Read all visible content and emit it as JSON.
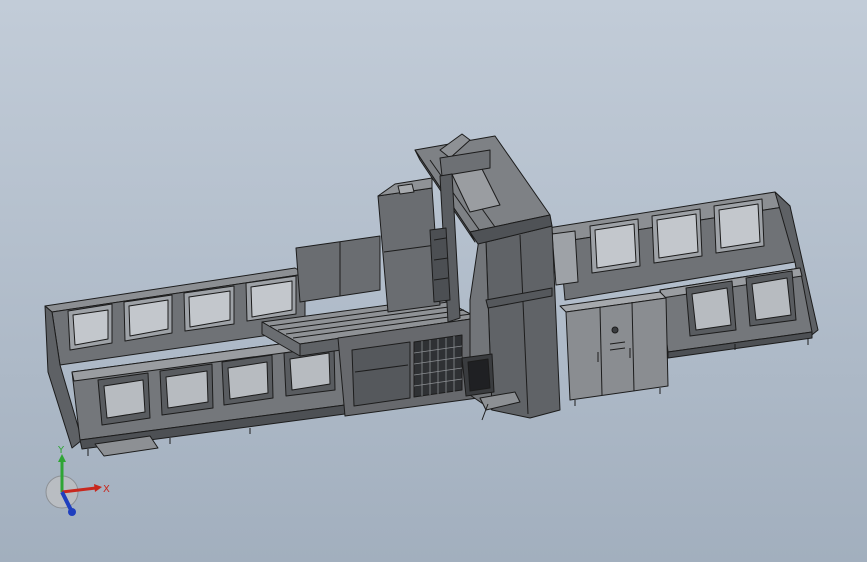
{
  "scene": {
    "background_top": "#c2ccd8",
    "background_bottom": "#a2afbe",
    "model_fill": "#7b7e82",
    "model_dark": "#56595d",
    "model_light": "#a9acb0",
    "edge_color": "#1c1c1c"
  },
  "triad": {
    "x_label": "X",
    "y_label": "Y",
    "x_color": "#c8281e",
    "y_color": "#2fa535",
    "z_color": "#1f3fbf"
  }
}
